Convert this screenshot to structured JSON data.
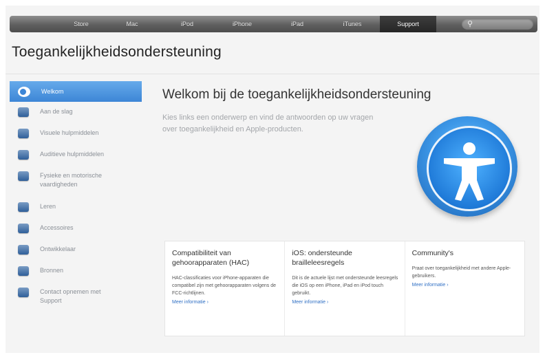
{
  "nav": {
    "apple_glyph": "",
    "items": [
      "Store",
      "Mac",
      "iPod",
      "iPhone",
      "iPad",
      "iTunes",
      "Support"
    ],
    "search_glyph": "⚲"
  },
  "page": {
    "title": "Toegankelijkheidsondersteuning"
  },
  "sidebar": {
    "items": [
      {
        "label": "Welkom",
        "active": true,
        "icon": "accessibility-icon"
      },
      {
        "label": "Aan de slag",
        "icon": "arrow-right-icon"
      },
      {
        "label": "Visuele hulpmiddelen",
        "icon": "display-icon"
      },
      {
        "label": "Auditieve hulpmiddelen",
        "icon": "audio-icon"
      },
      {
        "label": "Fysieke en motorische vaardigheden",
        "icon": "motor-icon"
      },
      {
        "label": "Leren",
        "icon": "learning-icon"
      },
      {
        "label": "Accessoires",
        "icon": "accessories-icon"
      },
      {
        "label": "Ontwikkelaar",
        "icon": "developer-icon"
      },
      {
        "label": "Bronnen",
        "icon": "resources-icon"
      },
      {
        "label": "Contact opnemen met Support",
        "icon": "contact-icon"
      }
    ]
  },
  "main": {
    "title": "Welkom bij de toegankelijkheidsondersteuning",
    "intro": "Kies links een onderwerp en vind de antwoorden op uw vragen over toegankelijkheid en Apple-producten.",
    "cards": [
      {
        "title": "Compatibiliteit van gehoorapparaten (HAC)",
        "body": "HAC-classificaties voor iPhone-apparaten die compatibel zijn met gehoorapparaten volgens de FCC-richtlijnen.",
        "link": "Meer informatie ›"
      },
      {
        "title": "iOS: ondersteunde brailleleesregels",
        "body": "Dit is de actuele lijst met ondersteunde leesregels die iOS op een iPhone, iPad en iPod touch gebruikt.",
        "link": "Meer informatie ›"
      },
      {
        "title": "Community's",
        "body": "Praat over toegankelijkheid met andere Apple-gebruikers.",
        "link": "Meer informatie ›"
      }
    ]
  },
  "colors": {
    "active_blue": "#3d86d6",
    "link_blue": "#2f6fc4",
    "nav_dark": "#4d4d4d"
  }
}
